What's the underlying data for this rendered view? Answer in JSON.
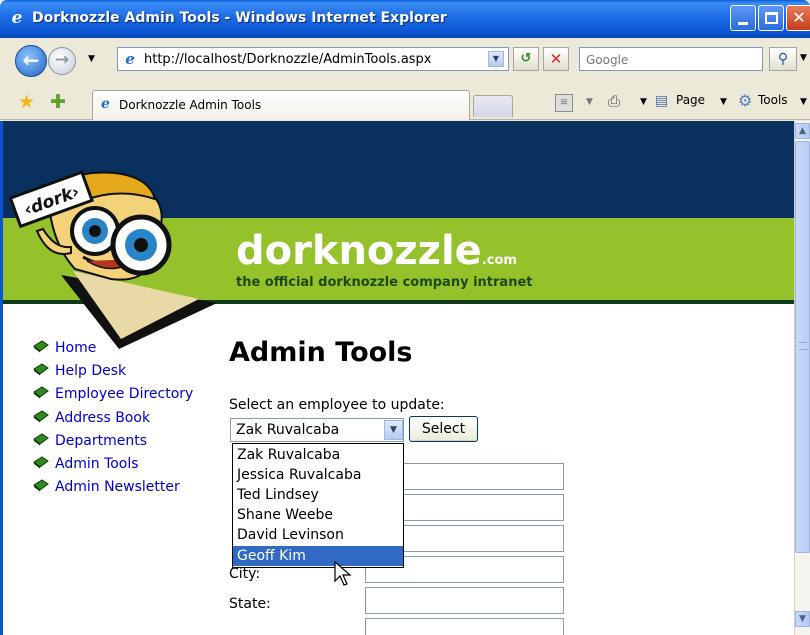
{
  "window": {
    "title": "Dorknozzle Admin Tools - Windows Internet Explorer",
    "icon": "ie-icon"
  },
  "toolbar": {
    "address": "http://localhost/Dorknozzle/AdminTools.aspx",
    "search_placeholder": "Google"
  },
  "tabs": {
    "active_label": "Dorknozzle Admin Tools",
    "page_label": "Page",
    "tools_label": "Tools"
  },
  "site": {
    "logo_sign": "‹dork›",
    "brand": "dorknozzle",
    "brand_suffix": ".com",
    "tagline": "the official dorknozzle company intranet"
  },
  "nav": {
    "items": [
      {
        "label": "Home"
      },
      {
        "label": "Help Desk"
      },
      {
        "label": "Employee Directory"
      },
      {
        "label": "Address Book"
      },
      {
        "label": "Departments"
      },
      {
        "label": "Admin Tools"
      },
      {
        "label": "Admin Newsletter"
      }
    ]
  },
  "main": {
    "title": "Admin Tools",
    "select_prompt": "Select an employee to update:",
    "selected_employee": "Zak Ruvalcaba",
    "select_button": "Select",
    "dropdown_options": [
      "Zak Ruvalcaba",
      "Jessica Ruvalcaba",
      "Ted Lindsey",
      "Shane Weebe",
      "David Levinson",
      "Geoff Kim"
    ],
    "highlighted_option": "Geoff Kim",
    "labels": {
      "city": "City:",
      "state": "State:"
    }
  },
  "colors": {
    "header_navy": "#0a3060",
    "header_green": "#95c12b",
    "link_blue": "#0000cc",
    "highlight": "#316ac5"
  }
}
